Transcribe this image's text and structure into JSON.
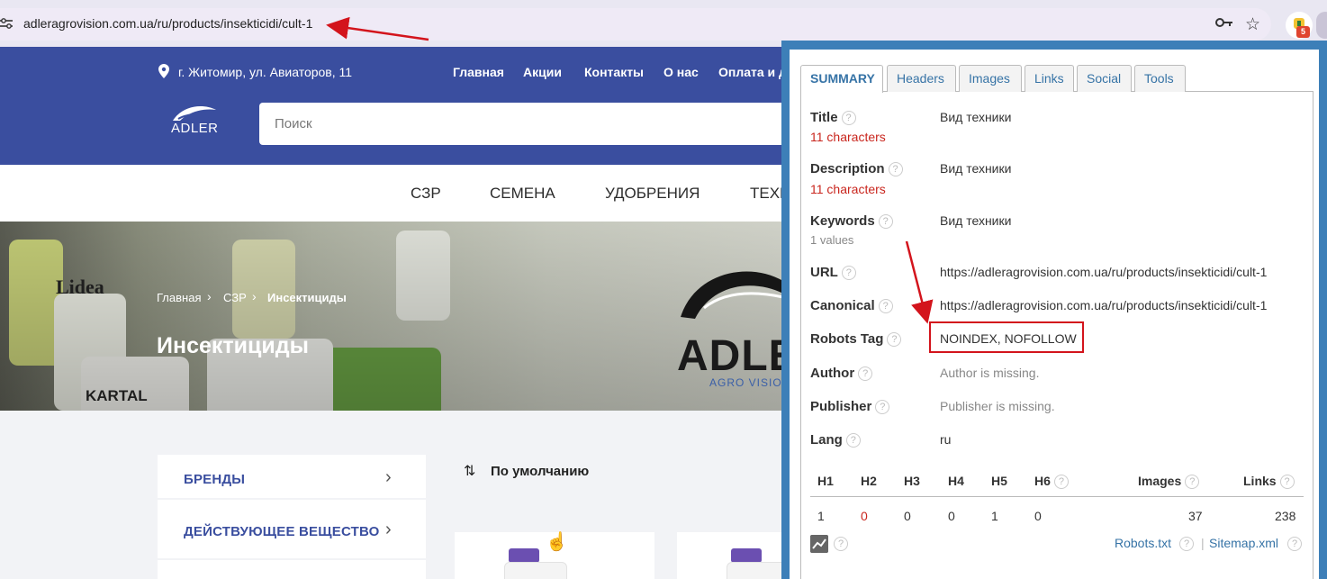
{
  "browser": {
    "url": "adleragrovision.com.ua/ru/products/insekticidi/cult-1",
    "extension_badge": "5"
  },
  "site": {
    "address": "г. Житомир, ул. Авиаторов, 11",
    "nav": [
      "Главная",
      "Акции",
      "Контакты",
      "О нас",
      "Оплата и д"
    ],
    "logo_word": "ADLER",
    "search_placeholder": "Поиск",
    "categories": [
      "СЗР",
      "СЕМЕНА",
      "УДОБРЕНИЯ",
      "ТЕХН"
    ],
    "breadcrumb": [
      "Главная",
      "СЗР",
      "Инсектициды"
    ],
    "breadcrumb_sep": "›",
    "page_title": "Инсектициды",
    "hero_brand": "ADLE",
    "hero_brand_sub": "AGRO VISIO",
    "hero_products": [
      "Lidea",
      "KARTAL"
    ],
    "filters": [
      "БРЕНДЫ",
      "ДЕЙСТВУЮЩЕЕ ВЕЩЕСТВО"
    ],
    "sort_label": "По умолчанию"
  },
  "seo": {
    "tabs": [
      "SUMMARY",
      "Headers",
      "Images",
      "Links",
      "Social",
      "Tools"
    ],
    "rows": {
      "title": {
        "label": "Title",
        "sub": "11 characters",
        "value": "Вид техники"
      },
      "description": {
        "label": "Description",
        "sub": "11 characters",
        "value": "Вид техники"
      },
      "keywords": {
        "label": "Keywords",
        "sub": "1 values",
        "value": "Вид техники"
      },
      "url": {
        "label": "URL",
        "value": "https://adleragrovision.com.ua/ru/products/insekticidi/cult-1"
      },
      "canonical": {
        "label": "Canonical",
        "value": "https://adleragrovision.com.ua/ru/products/insekticidi/cult-1"
      },
      "robots": {
        "label": "Robots Tag",
        "value": "NOINDEX, NOFOLLOW"
      },
      "author": {
        "label": "Author",
        "value": "Author is missing."
      },
      "publisher": {
        "label": "Publisher",
        "value": "Publisher is missing."
      },
      "lang": {
        "label": "Lang",
        "value": "ru"
      }
    },
    "headings": {
      "labels": [
        "H1",
        "H2",
        "H3",
        "H4",
        "H5",
        "H6",
        "Images",
        "Links"
      ],
      "values": [
        "1",
        "0",
        "0",
        "0",
        "1",
        "0",
        "37",
        "238"
      ]
    },
    "footer": {
      "robots_link": "Robots.txt",
      "sitemap_link": "Sitemap.xml",
      "separator": "|"
    },
    "help_glyph": "?"
  },
  "colors": {
    "brand_blue": "#3a4e9f",
    "panel_border": "#3d7fb8",
    "alert_red": "#d3141c"
  }
}
